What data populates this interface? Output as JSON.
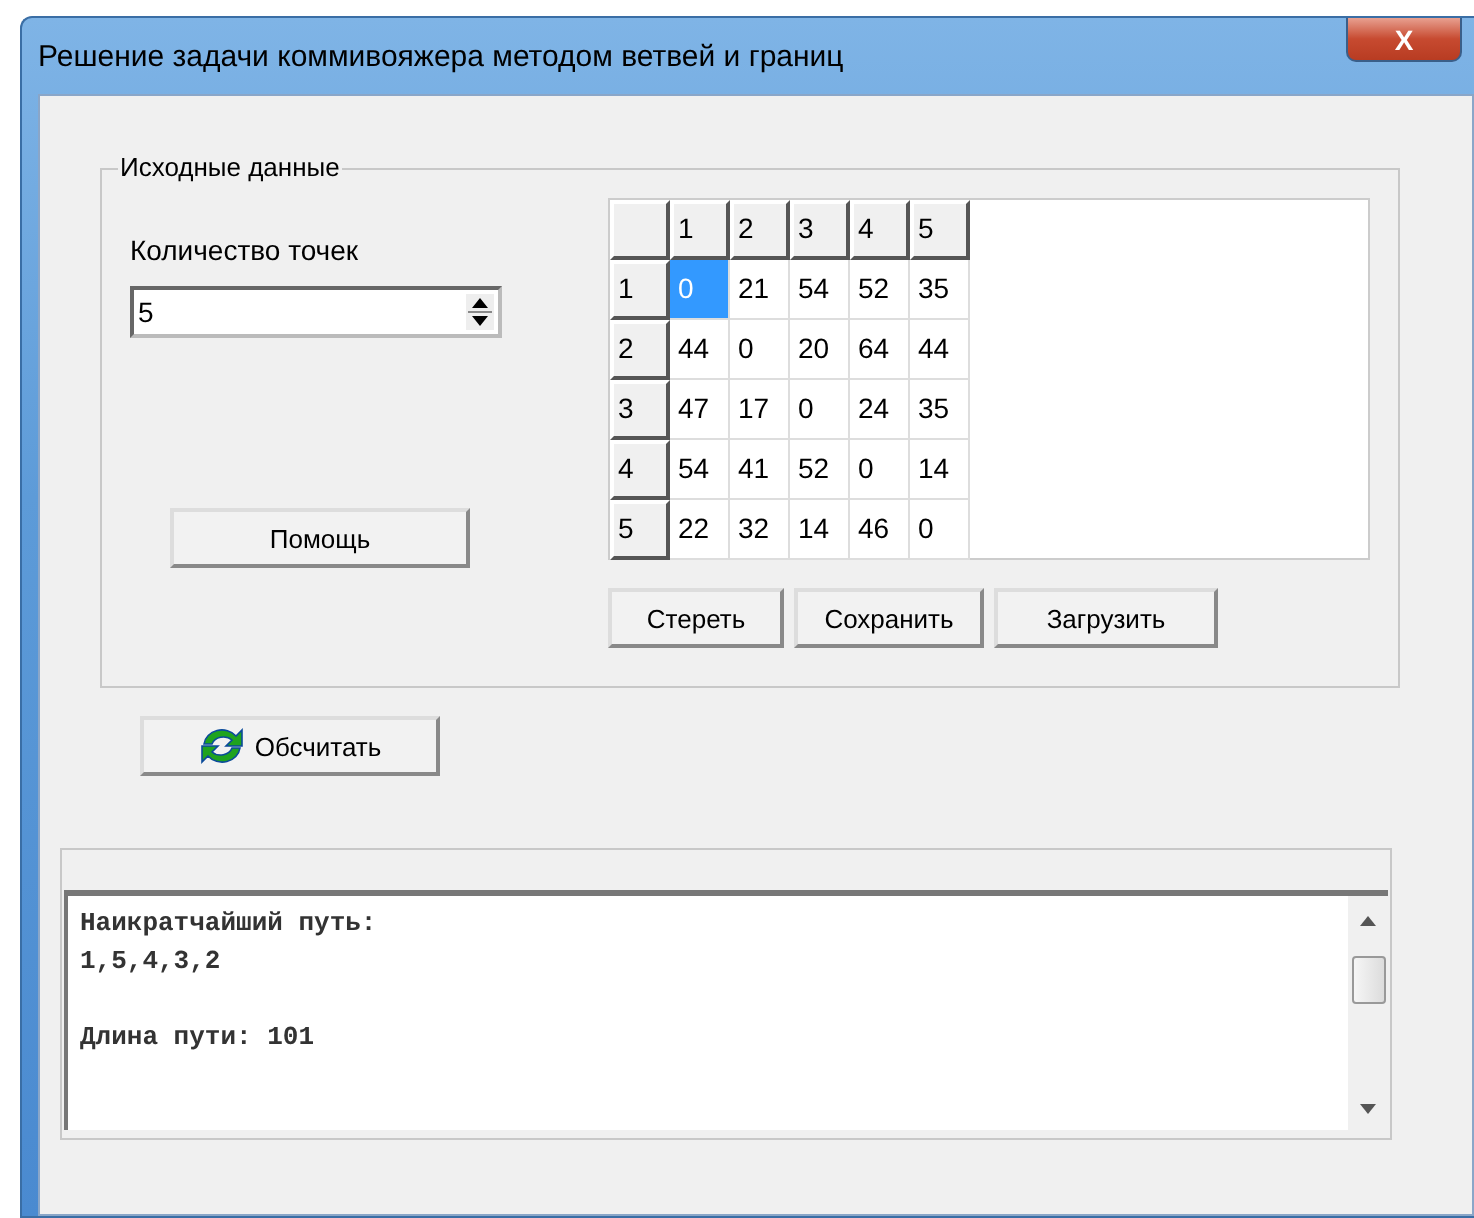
{
  "window": {
    "title": "Решение задачи коммивояжера методом ветвей и границ",
    "close": "X"
  },
  "input_group": {
    "title": "Исходные данные",
    "count_label": "Количество точек",
    "count_value": "5",
    "help_button": "Помощь"
  },
  "matrix": {
    "columns": [
      "1",
      "2",
      "3",
      "4",
      "5"
    ],
    "rows": [
      {
        "header": "1",
        "cells": [
          {
            "value": "0",
            "selected": true
          },
          {
            "value": "21",
            "selected": false
          },
          {
            "value": "54",
            "selected": false
          },
          {
            "value": "52",
            "selected": false
          },
          {
            "value": "35",
            "selected": false
          }
        ]
      },
      {
        "header": "2",
        "cells": [
          {
            "value": "44",
            "selected": false
          },
          {
            "value": "0",
            "selected": false
          },
          {
            "value": "20",
            "selected": false
          },
          {
            "value": "64",
            "selected": false
          },
          {
            "value": "44",
            "selected": false
          }
        ]
      },
      {
        "header": "3",
        "cells": [
          {
            "value": "47",
            "selected": false
          },
          {
            "value": "17",
            "selected": false
          },
          {
            "value": "0",
            "selected": false
          },
          {
            "value": "24",
            "selected": false
          },
          {
            "value": "35",
            "selected": false
          }
        ]
      },
      {
        "header": "4",
        "cells": [
          {
            "value": "54",
            "selected": false
          },
          {
            "value": "41",
            "selected": false
          },
          {
            "value": "52",
            "selected": false
          },
          {
            "value": "0",
            "selected": false
          },
          {
            "value": "14",
            "selected": false
          }
        ]
      },
      {
        "header": "5",
        "cells": [
          {
            "value": "22",
            "selected": false
          },
          {
            "value": "32",
            "selected": false
          },
          {
            "value": "14",
            "selected": false
          },
          {
            "value": "46",
            "selected": false
          },
          {
            "value": "0",
            "selected": false
          }
        ]
      }
    ],
    "buttons": [
      "Стереть",
      "Сохранить",
      "Загрузить"
    ]
  },
  "calculate_button": "Обсчитать",
  "output": {
    "paragraphs": [
      [
        "Наикратчайший путь:",
        "1,5,4,3,2"
      ],
      [
        "Длина пути: 101"
      ]
    ]
  }
}
